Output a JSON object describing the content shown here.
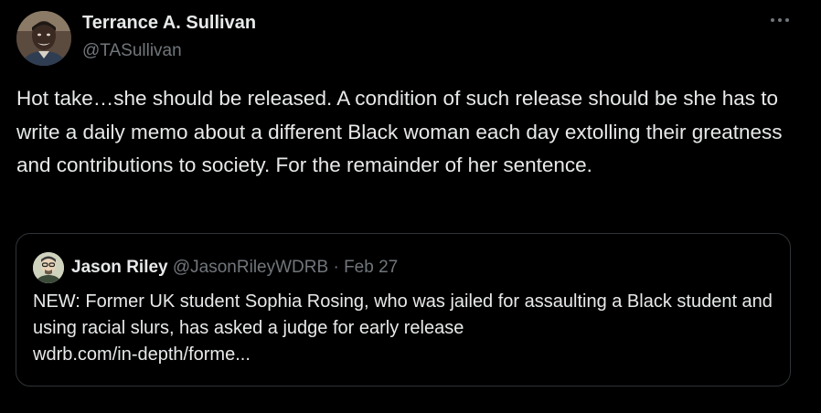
{
  "tweet": {
    "author_name": "Terrance A. Sullivan",
    "author_handle": "@TASullivan",
    "text": "Hot take…she should be released. A condition of such release should be she has to write a daily memo about a different Black woman each day extolling their greatness and contributions to society. For the remainder of her sentence.",
    "more_icon": "ellipsis-icon"
  },
  "quote": {
    "author_name": "Jason Riley",
    "author_handle": "@JasonRileyWDRB",
    "separator": " · ",
    "date": "Feb 27",
    "text": "NEW: Former UK student Sophia Rosing, who was jailed for assaulting a Black student and using racial slurs, has asked a judge for early release",
    "link": "wdrb.com/in-depth/forme..."
  },
  "colors": {
    "background": "#000000",
    "primary_text": "#e7e9ea",
    "secondary_text": "#71767b",
    "border": "#2f3336"
  }
}
